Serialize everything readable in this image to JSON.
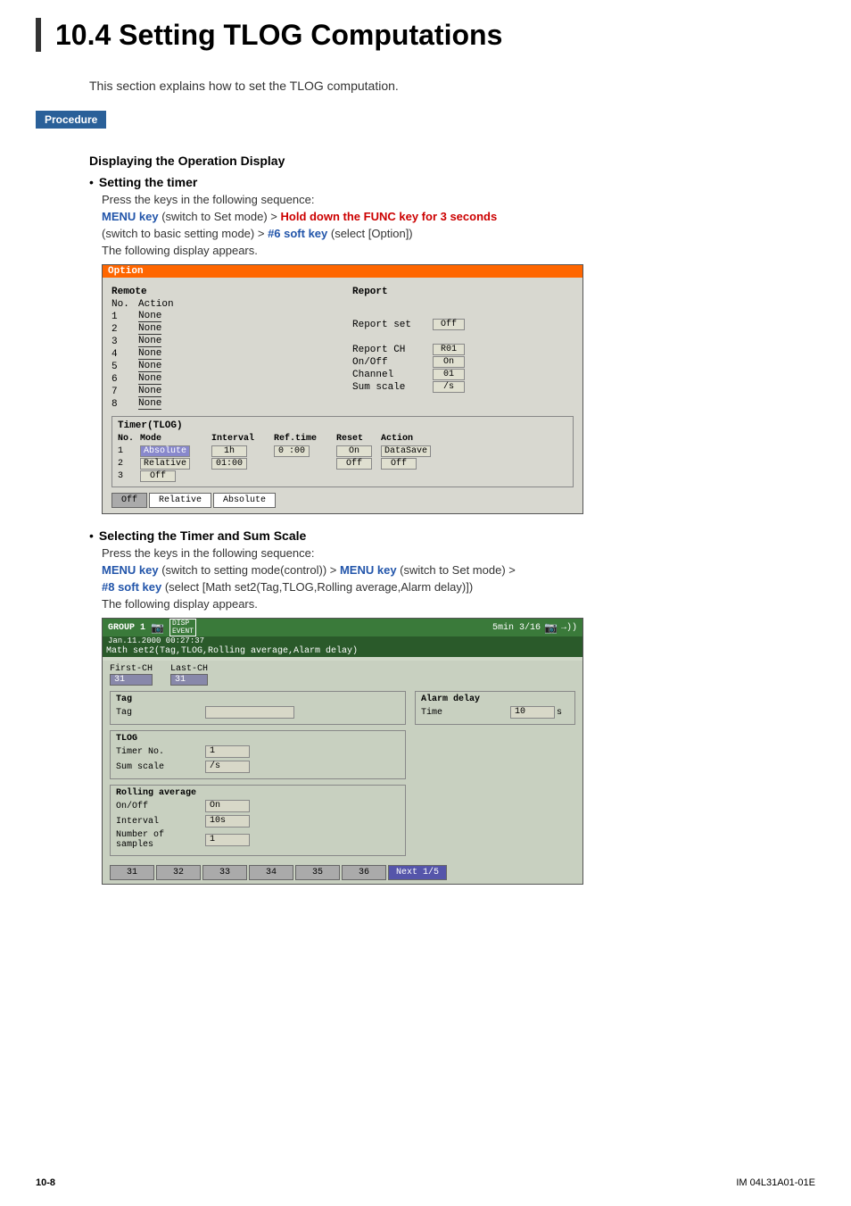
{
  "page": {
    "title": "10.4  Setting TLOG Computations",
    "footer_left": "10-8",
    "footer_right": "IM 04L31A01-01E",
    "intro": "This section explains how to set the TLOG computation."
  },
  "procedure": {
    "label": "Procedure"
  },
  "content": {
    "subsection1_title": "Displaying the Operation Display",
    "bullet1_label": "Setting the timer",
    "instr1": "Press the keys in the following sequence:",
    "instr2_part1": "MENU key",
    "instr2_part2": " (switch to Set mode) > ",
    "instr2_part3": "Hold down the FUNC key for 3 seconds",
    "instr2_part4": " (switch to basic setting mode) > ",
    "instr2_part5": "#6 soft key",
    "instr2_part6": " (select [Option])",
    "instr3": "The following display appears.",
    "option_screen": {
      "title": "Option",
      "remote_label": "Remote",
      "no_label": "No.",
      "action_label": "Action",
      "rows": [
        {
          "no": "1",
          "action": "None"
        },
        {
          "no": "2",
          "action": "None"
        },
        {
          "no": "3",
          "action": "None"
        },
        {
          "no": "4",
          "action": "None"
        },
        {
          "no": "5",
          "action": "None"
        },
        {
          "no": "6",
          "action": "None"
        },
        {
          "no": "7",
          "action": "None"
        },
        {
          "no": "8",
          "action": "None"
        }
      ],
      "report_label": "Report",
      "report_set_label": "Report set",
      "report_set_value": "Off",
      "report_ch_label": "Report CH",
      "report_ch_value": "R01",
      "on_off_label": "On/Off",
      "on_off_value": "On",
      "channel_label": "Channel",
      "channel_value": "01",
      "sum_scale_label": "Sum scale",
      "sum_scale_value": "/s",
      "timer_tlog_label": "Timer(TLOG)",
      "timer_no_label": "No.",
      "timer_mode_label": "Mode",
      "timer_interval_label": "Interval",
      "timer_reftime_label": "Ref.time",
      "timer_reset_label": "Reset",
      "timer_action_label": "Action",
      "timer_rows": [
        {
          "no": "1",
          "mode": "Absolute",
          "interval": "1h",
          "reftime": "0 :00",
          "reset": "On",
          "action": "DataSave"
        },
        {
          "no": "2",
          "mode": "Relative",
          "interval": "01:00",
          "reftime": "",
          "reset": "Off",
          "action": "Off"
        },
        {
          "no": "3",
          "mode": "Off",
          "interval": "",
          "reftime": "",
          "reset": "",
          "action": ""
        }
      ],
      "softkeys": [
        "Off",
        "Relative",
        "Absolute"
      ]
    },
    "bullet2_label": "Selecting the Timer and Sum Scale",
    "instr4": "Press the keys in the following sequence:",
    "instr5_part1": "MENU key",
    "instr5_part2": " (switch to setting mode(control)) > ",
    "instr5_part3": "MENU key",
    "instr5_part4": " (switch to Set mode) > ",
    "instr5_part5": "#8 soft key",
    "instr5_part6": " (select [Math set2(Tag,TLOG,Rolling average,Alarm delay)])",
    "instr6": "The following display appears.",
    "group_screen": {
      "title_group": "GROUP 1",
      "title_date": "Jan.11.2000 00:27:37",
      "disp_label": "DISP",
      "event_label": "EVENT",
      "status_right1": "5min 3/16",
      "status_right2": "→))",
      "math_bar_label": "Math set2(Tag,TLOG,Rolling average,Alarm delay)",
      "first_ch_label": "First-CH",
      "last_ch_label": "Last-CH",
      "first_ch_value": "31",
      "last_ch_value": "31",
      "tag_section_label": "Tag",
      "tag_label": "Tag",
      "tag_value": "",
      "alarm_delay_label": "Alarm delay",
      "time_label": "Time",
      "time_value": "10",
      "time_unit": "s",
      "tlog_section_label": "TLOG",
      "timer_no_label": "Timer No.",
      "timer_no_value": "1",
      "sum_scale_label": "Sum scale",
      "sum_scale_value": "/s",
      "rolling_avg_label": "Rolling average",
      "on_off_label": "On/Off",
      "on_off_value": "On",
      "interval_label": "Interval",
      "interval_value": "10s",
      "num_samples_label": "Number of samples",
      "num_samples_value": "1",
      "bottom_keys": [
        "31",
        "32",
        "33",
        "34",
        "35",
        "36",
        "Next 1/5"
      ]
    }
  }
}
